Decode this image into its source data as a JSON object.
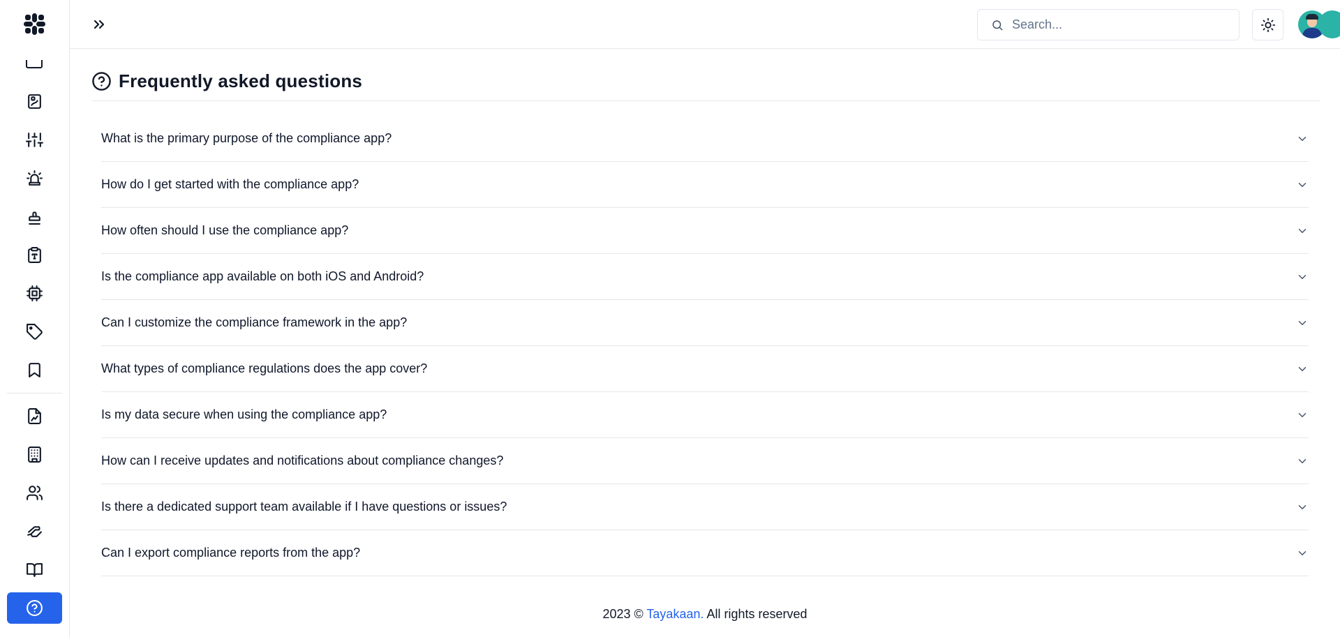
{
  "header": {
    "expand_icon": "chevrons-right-icon",
    "search_placeholder": "Search...",
    "theme_icon": "sun-icon"
  },
  "sidebar": {
    "items": [
      {
        "icon": "clipboard-chart-icon"
      },
      {
        "icon": "sliders-icon"
      },
      {
        "icon": "siren-icon"
      },
      {
        "icon": "stamp-icon"
      },
      {
        "icon": "clipboard-type-icon"
      },
      {
        "icon": "cpu-icon"
      },
      {
        "icon": "tag-icon"
      },
      {
        "icon": "bookmark-icon"
      },
      {
        "icon": "file-chart-icon"
      },
      {
        "icon": "building-icon"
      },
      {
        "icon": "users-icon"
      },
      {
        "icon": "handshake-icon"
      },
      {
        "icon": "book-open-icon"
      },
      {
        "icon": "help-circle-icon",
        "active": true
      }
    ]
  },
  "main": {
    "title": "Frequently asked questions",
    "faqs": [
      "What is the primary purpose of the compliance app?",
      "How do I get started with the compliance app?",
      "How often should I use the compliance app?",
      "Is the compliance app available on both iOS and Android?",
      "Can I customize the compliance framework in the app?",
      "What types of compliance regulations does the app cover?",
      "Is my data secure when using the compliance app?",
      "How can I receive updates and notifications about compliance changes?",
      "Is there a dedicated support team available if I have questions or issues?",
      "Can I export compliance reports from the app?"
    ]
  },
  "footer": {
    "prefix": "2023 © ",
    "brand": "Tayakaan.",
    "suffix": " All rights reserved"
  },
  "colors": {
    "accent": "#2563eb",
    "avatar_bg": "#2ab3a6",
    "status_online": "#22c55e"
  }
}
